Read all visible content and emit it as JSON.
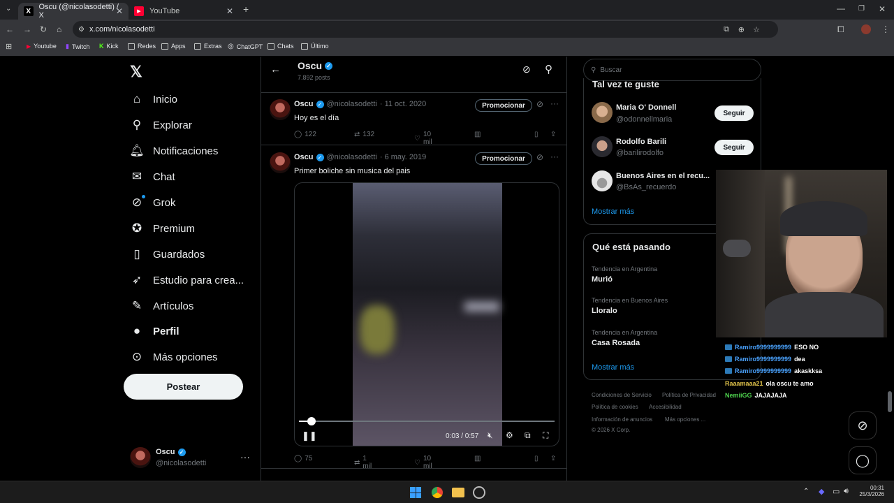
{
  "browser": {
    "tabs": [
      {
        "title": "Oscu (@nicolasodetti) / X",
        "active": true
      },
      {
        "title": "YouTube",
        "active": false
      }
    ],
    "url": "x.com/nicolasodetti",
    "bookmarks": [
      "Youtube",
      "Twitch",
      "Kick",
      "Redes",
      "Apps",
      "Extras",
      "ChatGPT",
      "Chats",
      "Último"
    ]
  },
  "nav": {
    "items": [
      "Inicio",
      "Explorar",
      "Notificaciones",
      "Chat",
      "Grok",
      "Premium",
      "Guardados",
      "Estudio para crea...",
      "Artículos",
      "Perfil",
      "Más opciones"
    ],
    "post_label": "Postear",
    "account": {
      "name": "Oscu",
      "handle": "@nicolasodetti"
    }
  },
  "profile_header": {
    "name": "Oscu",
    "posts": "7.892 posts"
  },
  "tweets": [
    {
      "name": "Oscu",
      "handle": "@nicolasodetti",
      "date": "· 11 oct. 2020",
      "text": "Hoy es el día",
      "promo": "Promocionar",
      "replies": "122",
      "reposts": "132",
      "likes": "10 mil"
    },
    {
      "name": "Oscu",
      "handle": "@nicolasodetti",
      "date": "· 6 may. 2019",
      "text": "Primer boliche sin musica del pais",
      "promo": "Promocionar",
      "replies": "75",
      "reposts": "1 mil",
      "likes": "10 mil"
    }
  ],
  "video": {
    "time": "0:03 / 0:57",
    "progress": 0.05
  },
  "search": {
    "placeholder": "Buscar"
  },
  "suggestions": {
    "title": "Tal vez te guste",
    "people": [
      {
        "name": "Maria O' Donnell",
        "handle": "@odonnellmaria",
        "follow": "Seguir"
      },
      {
        "name": "Rodolfo Barili",
        "handle": "@barilirodolfo",
        "follow": "Seguir"
      },
      {
        "name": "Buenos Aires en el recu...",
        "handle": "@BsAs_recuerdo"
      }
    ],
    "more": "Mostrar más"
  },
  "trends": {
    "title": "Qué está pasando",
    "items": [
      {
        "context": "Tendencia en Argentina",
        "topic": "Murió"
      },
      {
        "context": "Tendencia en Buenos Aires",
        "topic": "Lloralo"
      },
      {
        "context": "Tendencia en Argentina",
        "topic": "Casa Rosada"
      }
    ],
    "more": "Mostrar más"
  },
  "footer": {
    "links": [
      "Condiciones de Servicio",
      "Política de Privacidad",
      "Política de cookies",
      "Accesibilidad",
      "Información de anuncios",
      "Más opciones ...",
      "© 2026 X Corp."
    ]
  },
  "stream_chat": [
    {
      "user": "Ramiro9999999999",
      "msg": "ESO NO",
      "color": "#4aa3ff"
    },
    {
      "user": "Ramiro9999999999",
      "msg": "dea",
      "color": "#4aa3ff"
    },
    {
      "user": "Ramiro9999999999",
      "msg": "akaskksa",
      "color": "#4aa3ff"
    },
    {
      "user": "Raaamaaa21",
      "msg": "ola oscu te amo",
      "color": "#e0c24a"
    },
    {
      "user": "NemiiGG",
      "msg": "JAJAJAJA",
      "color": "#4ed14e"
    }
  ],
  "clock": {
    "time": "00:31",
    "date": "25/3/2026"
  }
}
